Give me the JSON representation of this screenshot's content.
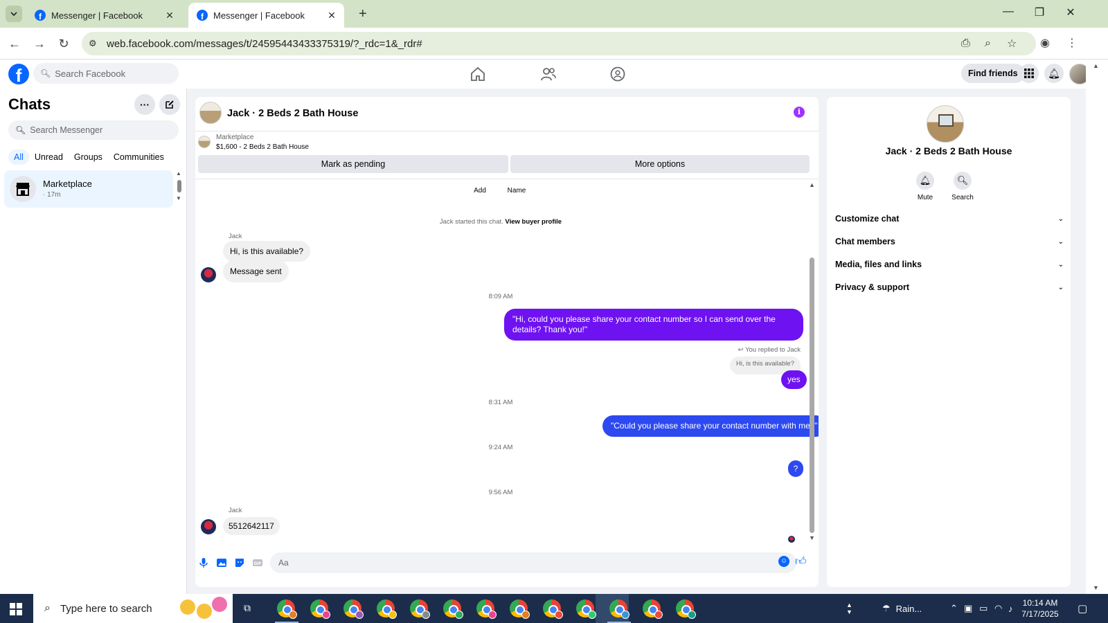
{
  "browser": {
    "tabs": [
      {
        "label": "Messenger | Facebook",
        "active": false
      },
      {
        "label": "Messenger | Facebook",
        "active": true
      }
    ],
    "new_tab": "+",
    "url": "web.facebook.com/messages/t/24595443433375319/?_rdc=1&_rdr#"
  },
  "facebook": {
    "logo": "f",
    "search_placeholder": "Search Facebook",
    "find_friends": "Find friends"
  },
  "sidebar": {
    "title": "Chats",
    "search_placeholder": "Search Messenger",
    "filters": [
      "All",
      "Unread",
      "Groups",
      "Communities"
    ],
    "chat": {
      "name": "Marketplace",
      "time": "· 17m"
    }
  },
  "conversation": {
    "title": "Jack · 2 Beds 2 Bath House",
    "marketplace_label": "Marketplace",
    "listing": "$1,600 - 2 Beds 2 Bath House",
    "mark_pending": "Mark as pending",
    "more_options": "More options",
    "partial_add": "Add",
    "partial_name": "Name",
    "system_text": "Jack started this chat.",
    "system_link": "View buyer profile",
    "sender1": "Jack",
    "msg1": "Hi, is this available?",
    "msg2": "Message sent",
    "time1": "8:09 AM",
    "out1": "\"Hi, could you please share your contact number so I can send over the details? Thank you!\"",
    "reply_note": "You replied to Jack",
    "reply_quote": "Hi, is this available?",
    "out2": "yes",
    "time2": "8:31 AM",
    "out3": "\"Could you please share your contact number with me?\"",
    "time3": "9:24 AM",
    "out4": "?",
    "time4": "9:56 AM",
    "sender2": "Jack",
    "msg3": "5512642117",
    "composer_placeholder": "Aa"
  },
  "info_panel": {
    "name": "Jack · 2 Beds 2 Bath House",
    "mute": "Mute",
    "search": "Search",
    "sections": [
      "Customize chat",
      "Chat members",
      "Media, files and links",
      "Privacy & support"
    ]
  },
  "taskbar": {
    "search_placeholder": "Type here to search",
    "weather": "Rain...",
    "time": "10:14 AM",
    "date": "7/17/2025"
  },
  "colors": {
    "accent_purple": "#6e12f2",
    "accent_blue": "#2d49f0",
    "facebook_blue": "#0866ff"
  }
}
